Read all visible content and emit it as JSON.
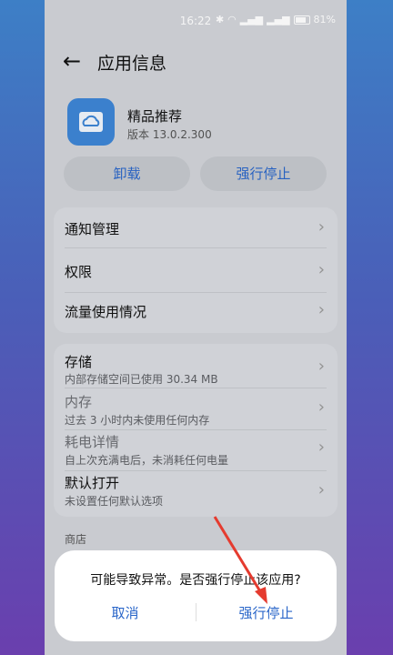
{
  "status_bar": {
    "time": "16:22",
    "battery": "81%"
  },
  "header": {
    "title": "应用信息",
    "back_icon": "arrow-left-icon"
  },
  "app": {
    "name": "精品推荐",
    "version": "版本 13.0.2.300",
    "icon": "cloud-folder-icon",
    "icon_color": "#3e86d6"
  },
  "actions": {
    "uninstall": "卸载",
    "force_stop": "强行停止"
  },
  "group1": [
    {
      "label": "通知管理"
    },
    {
      "label": "权限"
    },
    {
      "label": "流量使用情况"
    }
  ],
  "group2": [
    {
      "label": "存储",
      "sub": "内部存储空间已使用 30.34 MB"
    },
    {
      "label": "内存",
      "sub": "过去 3 小时内未使用任何内存"
    },
    {
      "label": "耗电详情",
      "sub": "自上次充满电后，未消耗任何电量"
    },
    {
      "label": "默认打开",
      "sub": "未设置任何默认选项"
    }
  ],
  "section": {
    "store_label": "商店"
  },
  "dialog": {
    "message": "可能导致异常。是否强行停止该应用?",
    "cancel": "取消",
    "confirm": "强行停止"
  },
  "colors": {
    "accent": "#2a66c9",
    "annotation_arrow": "#e53b2f"
  }
}
